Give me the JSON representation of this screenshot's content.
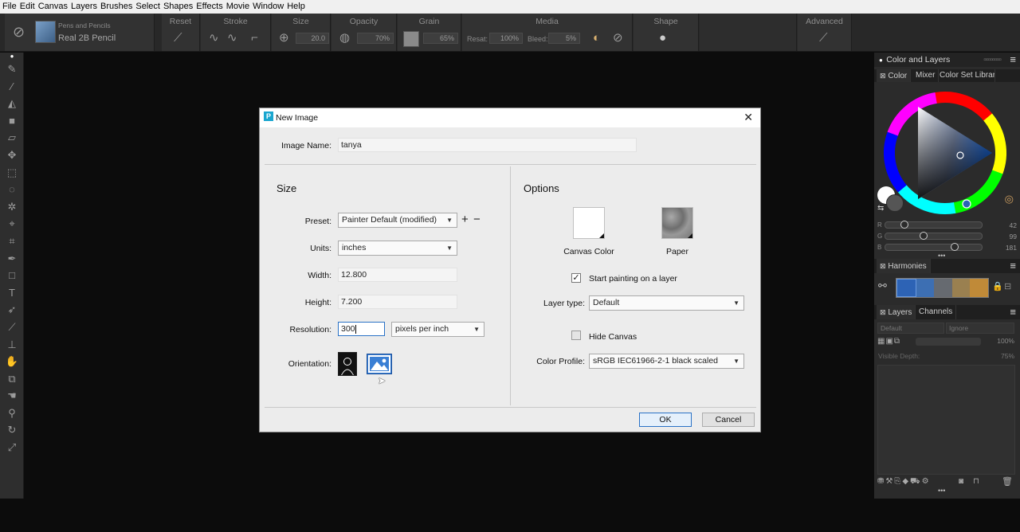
{
  "menubar": [
    "File",
    "Edit",
    "Canvas",
    "Layers",
    "Brushes",
    "Select",
    "Shapes",
    "Effects",
    "Movie",
    "Window",
    "Help"
  ],
  "brush": {
    "category": "Pens and Pencils",
    "variant": "Real 2B Pencil"
  },
  "props": {
    "reset": "Reset",
    "stroke": "Stroke",
    "size_title": "Size",
    "size_val": "20.0",
    "opacity_title": "Opacity",
    "opacity_val": "70%",
    "grain_title": "Grain",
    "grain_val": "65%",
    "media_title": "Media",
    "resat_label": "Resat:",
    "resat_val": "100%",
    "bleed_label": "Bleed:",
    "bleed_val": "5%",
    "shape_title": "Shape",
    "advanced_title": "Advanced"
  },
  "panel": {
    "color_layers_title": "Color and Layers",
    "tabs": [
      "Color",
      "Mixer",
      "Color Set Libraries"
    ],
    "rgb": [
      {
        "label": "R",
        "value": "42",
        "frac": 0.2
      },
      {
        "label": "G",
        "value": "99",
        "frac": 0.4
      },
      {
        "label": "B",
        "value": "181",
        "frac": 0.72
      }
    ],
    "harmonies_title": "Harmonies",
    "harmony_colors": [
      "#2d63b5",
      "#3d6fb3",
      "#666a70",
      "#9a8050",
      "#c08a38"
    ],
    "layers_tab": "Layers",
    "channels_tab": "Channels",
    "composite": "Default",
    "depth_method": "Ignore",
    "opacity": "100%",
    "visible_depth_label": "Visible Depth:",
    "visible_depth": "75%"
  },
  "dialog": {
    "title": "New Image",
    "image_name_label": "Image Name:",
    "image_name": "tanya",
    "size_title": "Size",
    "preset_label": "Preset:",
    "preset": "Painter Default (modified)",
    "units_label": "Units:",
    "units": "inches",
    "width_label": "Width:",
    "width": "12.800",
    "height_label": "Height:",
    "height": "7.200",
    "resolution_label": "Resolution:",
    "resolution": "300",
    "resolution_units": "pixels per inch",
    "orientation_label": "Orientation:",
    "options_title": "Options",
    "canvas_color_label": "Canvas Color",
    "paper_label": "Paper",
    "start_painting_label": "Start painting on a layer",
    "start_painting_checked": true,
    "layer_type_label": "Layer type:",
    "layer_type": "Default",
    "hide_canvas_label": "Hide Canvas",
    "hide_canvas_checked": false,
    "color_profile_label": "Color Profile:",
    "color_profile": "sRGB IEC61966-2-1 black scaled",
    "ok": "OK",
    "cancel": "Cancel"
  }
}
